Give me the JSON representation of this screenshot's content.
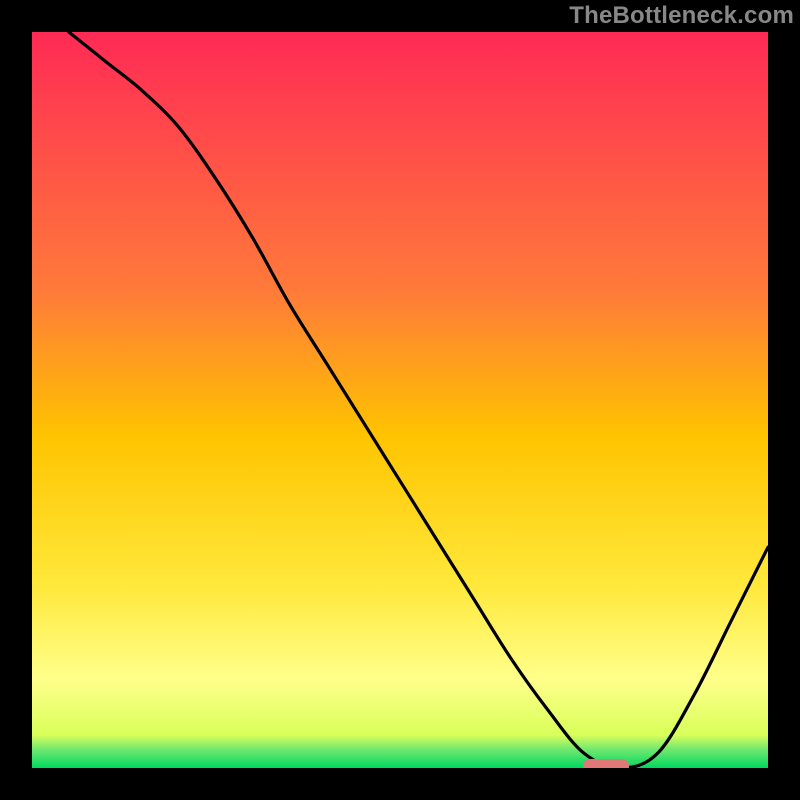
{
  "watermark": "TheBottleneck.com",
  "chart_data": {
    "type": "line",
    "title": "",
    "xlabel": "",
    "ylabel": "",
    "x_range": [
      0,
      100
    ],
    "y_range": [
      0,
      100
    ],
    "colors": {
      "gradient_top": "#ff2a55",
      "gradient_mid": "#ffc800",
      "gradient_low": "#ffff66",
      "gradient_bottom": "#00e060",
      "line_color": "#000000",
      "marker_color": "#e07878",
      "border": "#000000"
    },
    "gradient_stops": [
      {
        "offset": 0.0,
        "color": "#ff2a55"
      },
      {
        "offset": 0.35,
        "color": "#ff7a3a"
      },
      {
        "offset": 0.55,
        "color": "#ffc400"
      },
      {
        "offset": 0.75,
        "color": "#ffe83a"
      },
      {
        "offset": 0.88,
        "color": "#ffff8a"
      },
      {
        "offset": 0.955,
        "color": "#d9ff5a"
      },
      {
        "offset": 0.975,
        "color": "#6fe86f"
      },
      {
        "offset": 1.0,
        "color": "#00d860"
      }
    ],
    "series": [
      {
        "name": "bottleneck-curve",
        "x": [
          5,
          10,
          15,
          20,
          25,
          30,
          35,
          40,
          45,
          50,
          55,
          60,
          65,
          70,
          75,
          80,
          85,
          90,
          95,
          100
        ],
        "y": [
          100,
          96,
          92,
          87,
          80,
          72,
          63,
          55,
          47,
          39,
          31,
          23,
          15,
          8,
          2,
          0,
          2,
          10,
          20,
          30
        ]
      }
    ],
    "marker": {
      "name": "optimal-point",
      "x": 78,
      "y": 0,
      "shape": "rounded-bar",
      "color": "#e07878"
    },
    "description": "Vertical gradient from red (high mismatch) at top to green (balanced) at bottom. Black curve descends steeply from top-left, flattens near x≈75–80 at y≈0 (green zone), then rises again toward the right. A small salmon-red rounded marker sits at the curve minimum."
  }
}
